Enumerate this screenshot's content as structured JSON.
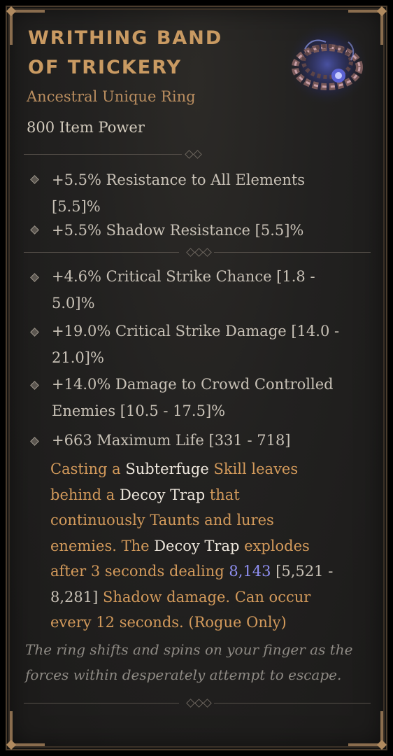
{
  "item": {
    "title_line1": "WRITHING BAND",
    "title_line2": "OF TRICKERY",
    "subtitle": "Ancestral Unique Ring",
    "item_power": "800 Item Power"
  },
  "affixes": [
    {
      "line1": "+5.5% Resistance to All Elements",
      "line2": "[5.5]%"
    },
    {
      "line1": "+5.5% Shadow Resistance [5.5]%"
    }
  ],
  "stats": [
    {
      "line1": "+4.6% Critical Strike Chance [1.8 -",
      "line2": "5.0]%"
    },
    {
      "line1": "+19.0% Critical Strike Damage [14.0 -",
      "line2": "21.0]%"
    },
    {
      "line1": "+14.0% Damage to Crowd Controlled",
      "line2": "Enemies [10.5 - 17.5]%"
    },
    {
      "line1": "+663 Maximum Life [331 - 718]"
    }
  ],
  "unique_power": {
    "l1a": "Casting a ",
    "l1b": "Subterfuge",
    "l1c": " Skill leaves",
    "l2a": "behind a ",
    "l2b": "Decoy Trap",
    "l2c": " that",
    "l3": "continuously Taunts and lures",
    "l4a": "enemies. The ",
    "l4b": "Decoy Trap",
    "l4c": " explodes",
    "l5a": "after 3 seconds dealing ",
    "l5b": "8,143",
    "l5c": " [5,521 -",
    "l6a": "8,281]",
    "l6b": " Shadow damage. Can occur",
    "l7": "every 12 seconds. (Rogue Only)"
  },
  "flavor": {
    "line1": "The ring shifts and spins on your finger as the",
    "line2": "forces within desperately attempt to escape."
  },
  "colors": {
    "title": "#c99a62",
    "subtitle": "#b98d5f",
    "unique_text": "#d39a5b",
    "value_highlight": "#8f8ff2"
  },
  "icons": {
    "item": "chain-ring-icon",
    "bullet": "diamond-bullet-icon"
  }
}
